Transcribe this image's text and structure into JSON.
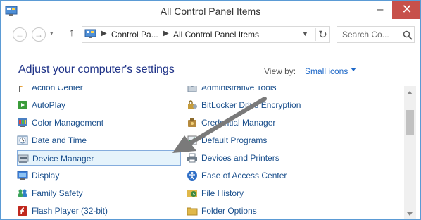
{
  "window": {
    "title": "All Control Panel Items",
    "minimize_glyph": "–",
    "close_glyph": "✕"
  },
  "navigation": {
    "back_icon": "back-arrow-icon",
    "forward_icon": "forward-arrow-icon",
    "up_icon": "up-arrow-icon",
    "breadcrumbs": [
      "Control Pa...",
      "All Control Panel Items"
    ],
    "search_placeholder": "Search Co...",
    "refresh_icon": "refresh-icon"
  },
  "content": {
    "heading": "Adjust your computer's settings",
    "view_by_label": "View by:",
    "view_by_value": "Small icons",
    "left_column": [
      {
        "label": "Action Center",
        "icon": "flag-icon",
        "color": "#e8a33b"
      },
      {
        "label": "AutoPlay",
        "icon": "autoplay-icon",
        "color": "#3a9c3a"
      },
      {
        "label": "Color Management",
        "icon": "color-management-icon",
        "color": "#4a7fc1"
      },
      {
        "label": "Date and Time",
        "icon": "clock-icon",
        "color": "#5b7fa6"
      },
      {
        "label": "Device Manager",
        "icon": "device-manager-icon",
        "color": "#7a8a9a",
        "selected": true
      },
      {
        "label": "Display",
        "icon": "display-icon",
        "color": "#3b7dd8"
      },
      {
        "label": "Family Safety",
        "icon": "family-safety-icon",
        "color": "#3aa45a"
      },
      {
        "label": "Flash Player (32-bit)",
        "icon": "flash-icon",
        "color": "#c0281e"
      }
    ],
    "right_column": [
      {
        "label": "Administrative Tools",
        "icon": "admin-tools-icon",
        "color": "#7c8da0"
      },
      {
        "label": "BitLocker Drive Encryption",
        "icon": "bitlocker-icon",
        "color": "#c69c3a"
      },
      {
        "label": "Credential Manager",
        "icon": "credential-icon",
        "color": "#b58a3e"
      },
      {
        "label": "Default Programs",
        "icon": "default-programs-icon",
        "color": "#2f8f4f"
      },
      {
        "label": "Devices and Printers",
        "icon": "printer-icon",
        "color": "#6d7b88"
      },
      {
        "label": "Ease of Access Center",
        "icon": "ease-of-access-icon",
        "color": "#2f6fc6"
      },
      {
        "label": "File History",
        "icon": "file-history-icon",
        "color": "#3d8a3d"
      },
      {
        "label": "Folder Options",
        "icon": "folder-icon",
        "color": "#e0b84a"
      }
    ]
  },
  "colors": {
    "heading": "#1e3287",
    "link": "#1a4f8c",
    "accent": "#1e68c8",
    "close_button": "#c7504a",
    "selection_bg": "#e5f3fb",
    "annotation_arrow": "#7a7a7a"
  }
}
